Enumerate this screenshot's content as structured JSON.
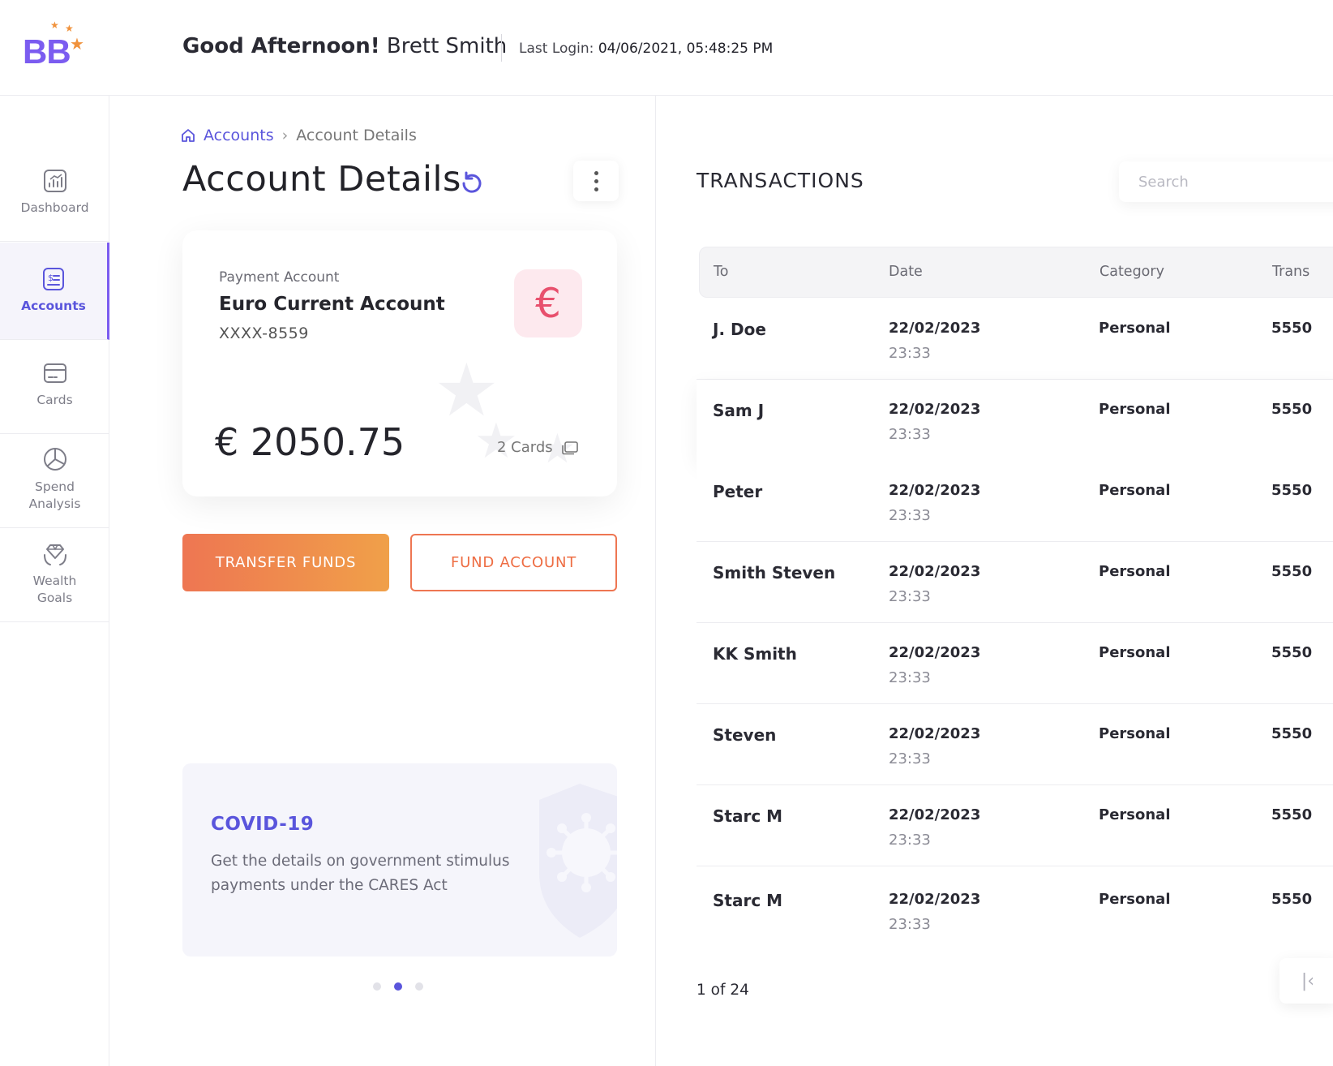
{
  "header": {
    "logo_text": "BB",
    "greeting": "Good Afternoon!",
    "user_name": "Brett Smith",
    "last_login_label": "Last Login:",
    "last_login_value": "04/06/2021, 05:48:25 PM"
  },
  "sidebar": {
    "items": [
      {
        "label": "Dashboard",
        "icon": "dashboard-icon",
        "active": false
      },
      {
        "label": "Accounts",
        "icon": "accounts-icon",
        "active": true
      },
      {
        "label": "Cards",
        "icon": "cards-icon",
        "active": false
      },
      {
        "label": "Spend Analysis",
        "icon": "pie-chart-icon",
        "active": false
      },
      {
        "label": "Wealth Goals",
        "icon": "diamond-hands-icon",
        "active": false
      }
    ]
  },
  "breadcrumb": {
    "root": "Accounts",
    "current": "Account Details"
  },
  "page": {
    "title": "Account Details"
  },
  "account_card": {
    "type": "Payment Account",
    "name": "Euro Current Account",
    "number": "XXXX-8559",
    "currency_symbol": "€",
    "balance": "€ 2050.75",
    "cards_count": "2 Cards"
  },
  "actions": {
    "transfer": "TRANSFER FUNDS",
    "fund": "FUND ACCOUNT"
  },
  "promo": {
    "title": "COVID-19",
    "text": "Get the details on government stimulus payments under the CARES Act",
    "slides": 3,
    "active_slide": 2
  },
  "transactions": {
    "title": "TRANSACTIONS",
    "search_placeholder": "Search",
    "columns": [
      "To",
      "Date",
      "Category",
      "Trans"
    ],
    "rows": [
      {
        "to": "J. Doe",
        "date": "22/02/2023",
        "time": "23:33",
        "category": "Personal",
        "trans": "5550"
      },
      {
        "to": "Sam J",
        "date": "22/02/2023",
        "time": "23:33",
        "category": "Personal",
        "trans": "5550"
      },
      {
        "to": "Peter",
        "date": "22/02/2023",
        "time": "23:33",
        "category": "Personal",
        "trans": "5550"
      },
      {
        "to": "Smith Steven",
        "date": "22/02/2023",
        "time": "23:33",
        "category": "Personal",
        "trans": "5550"
      },
      {
        "to": "KK Smith",
        "date": "22/02/2023",
        "time": "23:33",
        "category": "Personal",
        "trans": "5550"
      },
      {
        "to": "Steven",
        "date": "22/02/2023",
        "time": "23:33",
        "category": "Personal",
        "trans": "5550"
      },
      {
        "to": "Starc M",
        "date": "22/02/2023",
        "time": "23:33",
        "category": "Personal",
        "trans": "5550"
      },
      {
        "to": "Starc M",
        "date": "22/02/2023",
        "time": "23:33",
        "category": "Personal",
        "trans": "5550"
      }
    ],
    "pagination": "1 of 24"
  },
  "colors": {
    "brand": "#5a55dc",
    "accent": "#ee7652",
    "euro": "#e8506d"
  }
}
